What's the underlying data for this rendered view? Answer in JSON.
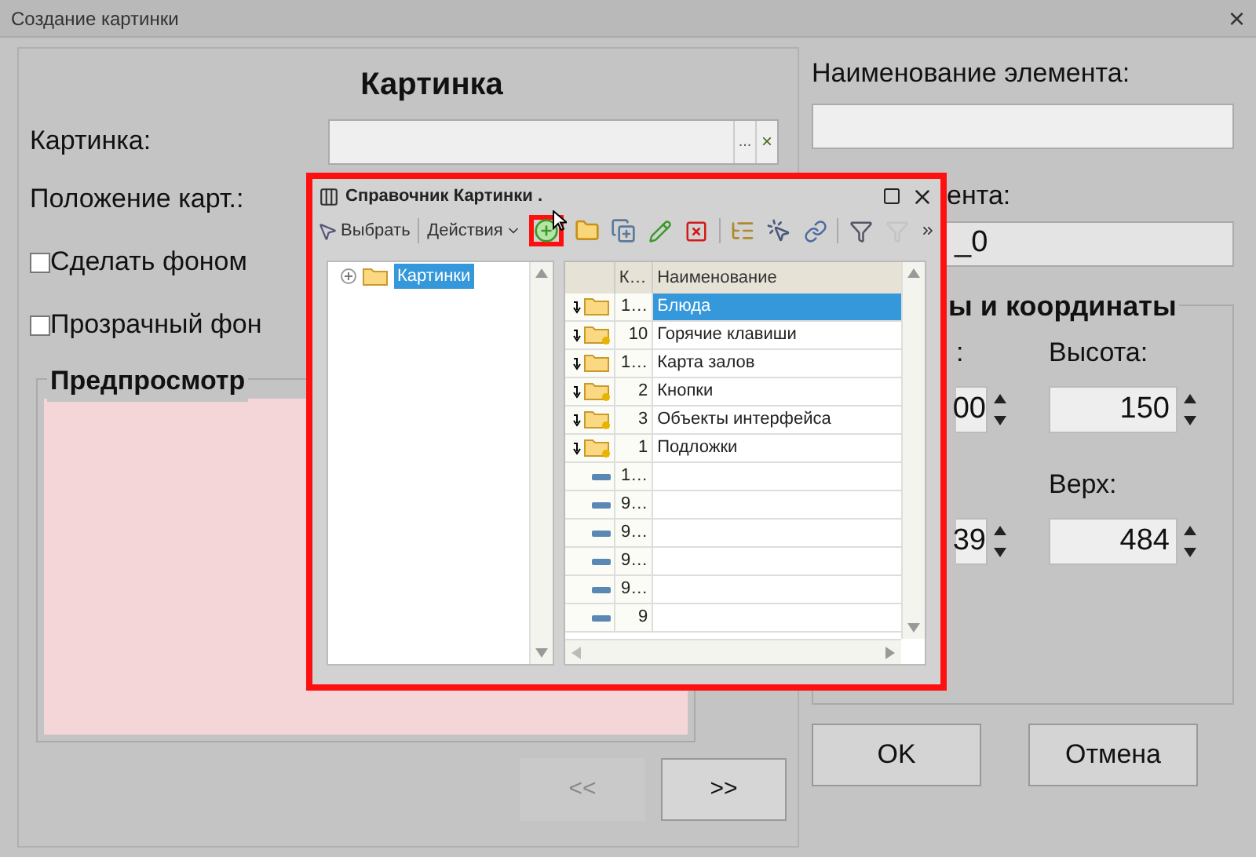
{
  "window": {
    "title": "Создание картинки",
    "close": "×"
  },
  "left_panel": {
    "heading": "Картинка",
    "picture_label": "Картинка:",
    "picture_choose": "...",
    "picture_clear": "×",
    "position_label": "Положение карт.:",
    "checkboxes": [
      {
        "label": "Сделать фоном",
        "checked": false
      },
      {
        "label": "Прозрачный фон",
        "checked": false
      }
    ],
    "preview_title": "Предпросмотр",
    "nav_buttons": [
      {
        "label": "<<",
        "disabled": true
      },
      {
        "label": ">>",
        "disabled": false
      }
    ]
  },
  "right_panel": {
    "name_label": "Наименование элемента:",
    "id_label": "ента:",
    "id_value": "_0",
    "group_title": "ы и координаты",
    "spinners": [
      {
        "label": ":",
        "value": "00"
      },
      {
        "value": "39"
      },
      {
        "label": "Высота:",
        "value": "150"
      },
      {
        "label": "Верх:",
        "value": "484"
      }
    ]
  },
  "buttons": [
    {
      "label": "OK"
    },
    {
      "label": "Отмена"
    }
  ],
  "catalog": {
    "title": "Справочник Картинки .",
    "select": "Выбрать",
    "actions": "Действия",
    "tools": [
      {
        "kind": "add",
        "highlighted": true,
        "disabled": false
      },
      {
        "kind": "add-folder",
        "highlighted": false,
        "disabled": false
      },
      {
        "kind": "copy",
        "highlighted": false,
        "disabled": false
      },
      {
        "kind": "edit",
        "highlighted": false,
        "disabled": false
      },
      {
        "kind": "delete",
        "highlighted": false,
        "disabled": false
      },
      {
        "kind": "separator"
      },
      {
        "kind": "hierarchy",
        "highlighted": false,
        "disabled": false
      },
      {
        "kind": "pick",
        "highlighted": false,
        "disabled": false
      },
      {
        "kind": "link",
        "highlighted": false,
        "disabled": false
      },
      {
        "kind": "separator"
      },
      {
        "kind": "filter",
        "highlighted": false,
        "disabled": false
      },
      {
        "kind": "filter",
        "highlighted": false,
        "disabled": true
      }
    ],
    "tree": [
      {
        "label": "Картинки",
        "selected": true,
        "expanded": false
      }
    ],
    "columns": [
      "К…",
      "Наименование"
    ],
    "rows": [
      {
        "kind": "folder",
        "marked": false,
        "code": "1…",
        "name": "Блюда",
        "selected": true
      },
      {
        "kind": "folder",
        "marked": true,
        "code": "10",
        "name": "Горячие клавиши",
        "selected": false
      },
      {
        "kind": "folder",
        "marked": false,
        "code": "1…",
        "name": "Карта залов",
        "selected": false
      },
      {
        "kind": "folder",
        "marked": true,
        "code": "2",
        "name": "Кнопки",
        "selected": false
      },
      {
        "kind": "folder",
        "marked": true,
        "code": "3",
        "name": "Объекты интерфейса",
        "selected": false
      },
      {
        "kind": "folder",
        "marked": true,
        "code": "1",
        "name": "Подложки",
        "selected": false
      },
      {
        "kind": "item",
        "code": "1…",
        "selected": false
      },
      {
        "kind": "item",
        "code": "9…",
        "selected": false
      },
      {
        "kind": "item",
        "code": "9…",
        "selected": false
      },
      {
        "kind": "item",
        "code": "9…",
        "selected": false
      },
      {
        "kind": "item",
        "code": "9…",
        "selected": false
      },
      {
        "kind": "item",
        "code": "9",
        "selected": false
      }
    ]
  }
}
